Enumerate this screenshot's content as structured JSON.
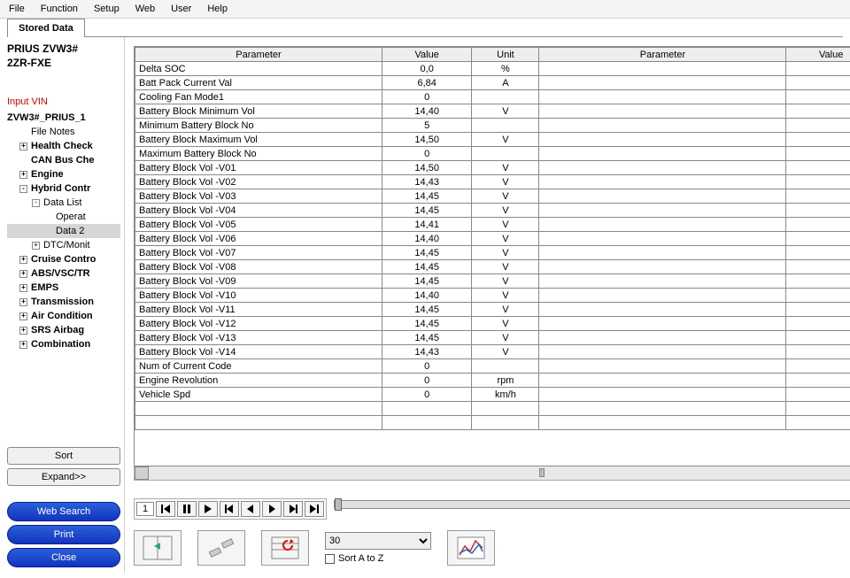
{
  "menu": [
    "File",
    "Function",
    "Setup",
    "Web",
    "User",
    "Help"
  ],
  "tab": "Stored Data",
  "vehicle": {
    "line1": "PRIUS ZVW3#",
    "line2": "2ZR-FXE"
  },
  "input_vin_label": "Input VIN",
  "tree": {
    "root": "ZVW3#_PRIUS_1",
    "file_notes": "File Notes",
    "items": [
      {
        "label": "Health Check",
        "exp": "+",
        "bold": true
      },
      {
        "label": "CAN Bus Che",
        "exp": "",
        "bold": true
      },
      {
        "label": "Engine",
        "exp": "+",
        "bold": true
      },
      {
        "label": "Hybrid Contr",
        "exp": "-",
        "bold": true,
        "children": [
          {
            "label": "Data List",
            "exp": "-",
            "children": [
              {
                "label": "Operat"
              },
              {
                "label": "Data 2",
                "selected": true
              }
            ]
          },
          {
            "label": "DTC/Monit",
            "exp": "+"
          }
        ]
      },
      {
        "label": "Cruise Contro",
        "exp": "+",
        "bold": true
      },
      {
        "label": "ABS/VSC/TR",
        "exp": "+",
        "bold": true
      },
      {
        "label": "EMPS",
        "exp": "+",
        "bold": true
      },
      {
        "label": "Transmission",
        "exp": "+",
        "bold": true
      },
      {
        "label": "Air Condition",
        "exp": "+",
        "bold": true
      },
      {
        "label": "SRS Airbag",
        "exp": "+",
        "bold": true
      },
      {
        "label": "Combination",
        "exp": "+",
        "bold": true
      }
    ]
  },
  "side_buttons": {
    "sort": "Sort",
    "expand": "Expand>>",
    "web": "Web Search",
    "print": "Print",
    "close": "Close"
  },
  "table": {
    "headers": {
      "param": "Parameter",
      "value": "Value",
      "unit": "Unit"
    },
    "rows": [
      {
        "p": "Delta SOC",
        "v": "0,0",
        "u": "%"
      },
      {
        "p": "Batt Pack Current Val",
        "v": "6,84",
        "u": "A"
      },
      {
        "p": "Cooling Fan Mode1",
        "v": "0",
        "u": ""
      },
      {
        "p": "Battery Block Minimum Vol",
        "v": "14,40",
        "u": "V"
      },
      {
        "p": "Minimum Battery Block No",
        "v": "5",
        "u": ""
      },
      {
        "p": "Battery Block Maximum Vol",
        "v": "14,50",
        "u": "V"
      },
      {
        "p": "Maximum Battery Block No",
        "v": "0",
        "u": ""
      },
      {
        "p": "Battery Block Vol -V01",
        "v": "14,50",
        "u": "V"
      },
      {
        "p": "Battery Block Vol -V02",
        "v": "14,43",
        "u": "V"
      },
      {
        "p": "Battery Block Vol -V03",
        "v": "14,45",
        "u": "V"
      },
      {
        "p": "Battery Block Vol -V04",
        "v": "14,45",
        "u": "V"
      },
      {
        "p": "Battery Block Vol -V05",
        "v": "14,41",
        "u": "V"
      },
      {
        "p": "Battery Block Vol -V06",
        "v": "14,40",
        "u": "V"
      },
      {
        "p": "Battery Block Vol -V07",
        "v": "14,45",
        "u": "V"
      },
      {
        "p": "Battery Block Vol -V08",
        "v": "14,45",
        "u": "V"
      },
      {
        "p": "Battery Block Vol -V09",
        "v": "14,45",
        "u": "V"
      },
      {
        "p": "Battery Block Vol -V10",
        "v": "14,40",
        "u": "V"
      },
      {
        "p": "Battery Block Vol -V11",
        "v": "14,45",
        "u": "V"
      },
      {
        "p": "Battery Block Vol -V12",
        "v": "14,45",
        "u": "V"
      },
      {
        "p": "Battery Block Vol -V13",
        "v": "14,45",
        "u": "V"
      },
      {
        "p": "Battery Block Vol -V14",
        "v": "14,43",
        "u": "V"
      },
      {
        "p": "Num of Current Code",
        "v": "0",
        "u": ""
      },
      {
        "p": "Engine Revolution",
        "v": "0",
        "u": "rpm"
      },
      {
        "p": "Vehicle Spd",
        "v": "0",
        "u": "km/h"
      },
      {
        "p": "",
        "v": "",
        "u": ""
      },
      {
        "p": "",
        "v": "",
        "u": ""
      }
    ]
  },
  "playback": {
    "frame": "1"
  },
  "toolrow": {
    "interval": "30",
    "sort_label": "Sort A to Z"
  }
}
